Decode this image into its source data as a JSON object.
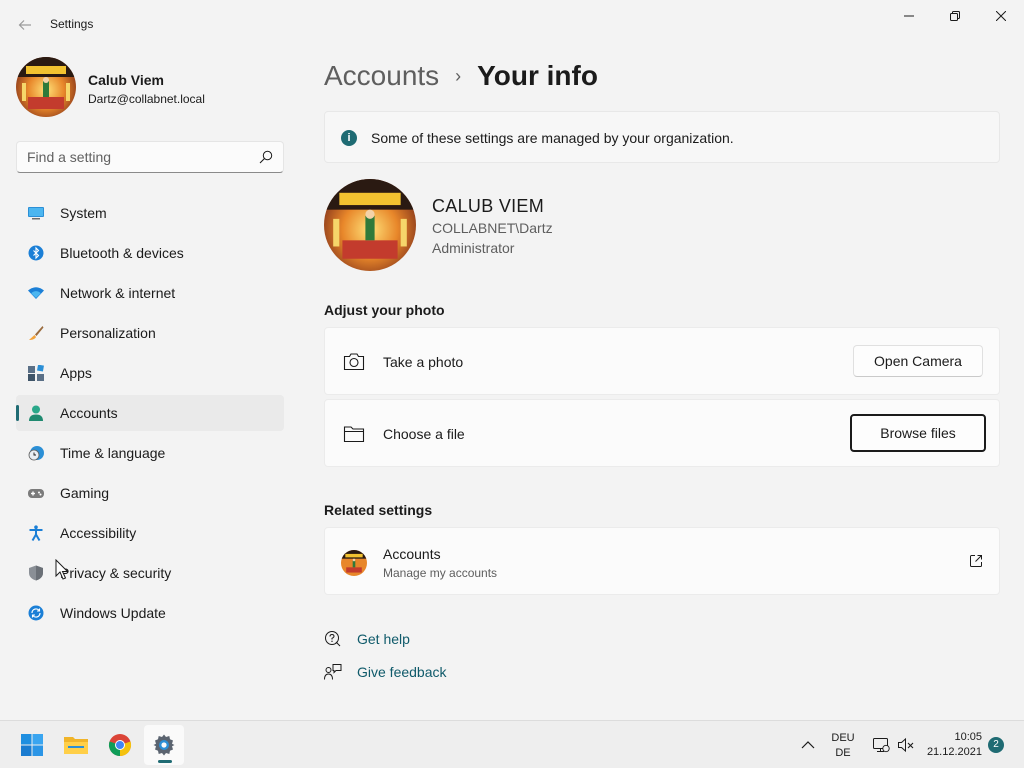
{
  "window": {
    "title": "Settings",
    "controls": {
      "minimize": "minimize-icon",
      "maximize": "restore-icon",
      "close": "close-icon"
    }
  },
  "profile": {
    "name": "Calub Viem",
    "email": "Dartz@collabnet.local"
  },
  "search": {
    "placeholder": "Find a setting",
    "value": ""
  },
  "sidebar": {
    "items": [
      {
        "label": "System",
        "icon": "system-icon"
      },
      {
        "label": "Bluetooth & devices",
        "icon": "bluetooth-icon"
      },
      {
        "label": "Network & internet",
        "icon": "wifi-icon"
      },
      {
        "label": "Personalization",
        "icon": "brush-icon"
      },
      {
        "label": "Apps",
        "icon": "apps-icon"
      },
      {
        "label": "Accounts",
        "icon": "person-icon",
        "active": true
      },
      {
        "label": "Time & language",
        "icon": "clock-globe-icon"
      },
      {
        "label": "Gaming",
        "icon": "gamepad-icon"
      },
      {
        "label": "Accessibility",
        "icon": "accessibility-icon"
      },
      {
        "label": "Privacy & security",
        "icon": "shield-icon"
      },
      {
        "label": "Windows Update",
        "icon": "update-icon"
      }
    ]
  },
  "breadcrumb": {
    "parent": "Accounts",
    "separator": "›",
    "current": "Your info"
  },
  "info_bar": {
    "icon": "info-icon",
    "text": "Some of these settings are managed by your organization."
  },
  "user": {
    "display_name": "CALUB VIEM",
    "domain_account": "COLLABNET\\Dartz",
    "role": "Administrator"
  },
  "adjust_photo": {
    "title": "Adjust your photo",
    "take_photo": {
      "label": "Take a photo",
      "button": "Open Camera",
      "icon": "camera-icon"
    },
    "choose_file": {
      "label": "Choose a file",
      "button": "Browse files",
      "icon": "folder-icon"
    }
  },
  "related": {
    "title": "Related settings",
    "item": {
      "title": "Accounts",
      "subtitle": "Manage my accounts",
      "icon": "external-link-icon"
    }
  },
  "help": {
    "get_help": "Get help",
    "give_feedback": "Give feedback"
  },
  "taskbar": {
    "apps": [
      "start-icon",
      "file-explorer-icon",
      "chrome-icon",
      "settings-icon"
    ],
    "language": {
      "line1": "DEU",
      "line2": "DE"
    },
    "time": "10:05",
    "date": "21.12.2021",
    "notifications": "2"
  },
  "colors": {
    "accent": "#1f6b73",
    "background": "#f3f3f3",
    "link": "#0f5a6a"
  }
}
